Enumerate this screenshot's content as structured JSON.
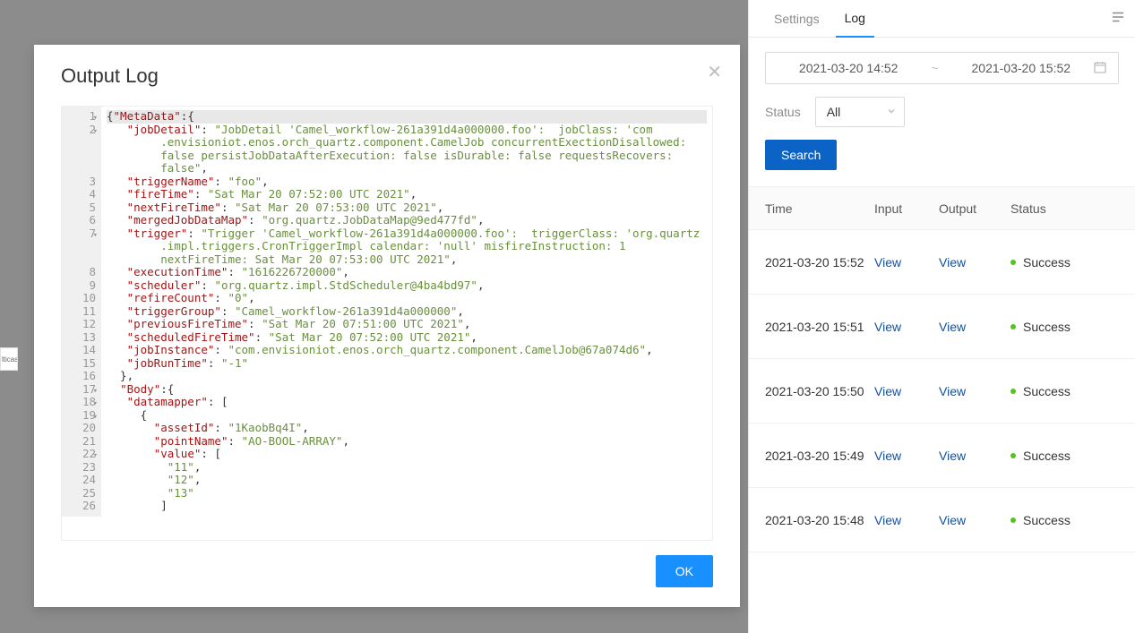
{
  "sidepanel": {
    "tabs": {
      "settings": "Settings",
      "log": "Log"
    },
    "activeTab": "log",
    "dateFrom": "2021-03-20 14:52",
    "dateSep": "~",
    "dateTo": "2021-03-20 15:52",
    "statusLabel": "Status",
    "statusValue": "All",
    "searchLabel": "Search",
    "columns": {
      "time": "Time",
      "input": "Input",
      "output": "Output",
      "status": "Status"
    },
    "viewLabel": "View",
    "rows": [
      {
        "time": "2021-03-20 15:52",
        "status": "Success",
        "statusColor": "green"
      },
      {
        "time": "2021-03-20 15:51",
        "status": "Success",
        "statusColor": "green"
      },
      {
        "time": "2021-03-20 15:50",
        "status": "Success",
        "statusColor": "green"
      },
      {
        "time": "2021-03-20 15:49",
        "status": "Success",
        "statusColor": "green"
      },
      {
        "time": "2021-03-20 15:48",
        "status": "Success",
        "statusColor": "green"
      }
    ]
  },
  "leftFragment": "lticast",
  "modal": {
    "title": "Output Log",
    "okLabel": "OK",
    "code": {
      "lineNumbers": [
        1,
        2,
        3,
        4,
        5,
        6,
        7,
        8,
        9,
        10,
        11,
        12,
        13,
        14,
        15,
        16,
        17,
        18,
        19,
        20,
        21,
        22,
        23,
        24,
        25,
        26
      ],
      "foldLines": [
        1,
        2,
        7,
        17,
        18,
        19,
        22
      ],
      "lines": [
        [
          {
            "t": "{",
            "c": "p"
          },
          {
            "t": "\"MetaData\"",
            "c": "k"
          },
          {
            "t": ":{",
            "c": "p"
          }
        ],
        [
          {
            "t": "   ",
            "c": "p"
          },
          {
            "t": "\"jobDetail\"",
            "c": "k"
          },
          {
            "t": ": ",
            "c": "p"
          },
          {
            "t": "\"JobDetail 'Camel_workflow-261a391d4a000000.foo':  jobClass: 'com",
            "c": "s"
          }
        ],
        [
          {
            "t": "        ",
            "c": "p"
          },
          {
            "t": ".envisioniot.enos.orch_quartz.component.CamelJob concurrentExectionDisallowed: ",
            "c": "s"
          }
        ],
        [
          {
            "t": "        ",
            "c": "p"
          },
          {
            "t": "false persistJobDataAfterExecution: false isDurable: false requestsRecovers: ",
            "c": "s"
          }
        ],
        [
          {
            "t": "        ",
            "c": "p"
          },
          {
            "t": "false\"",
            "c": "s"
          },
          {
            "t": ",",
            "c": "p"
          }
        ],
        [
          {
            "t": "   ",
            "c": "p"
          },
          {
            "t": "\"triggerName\"",
            "c": "k"
          },
          {
            "t": ": ",
            "c": "p"
          },
          {
            "t": "\"foo\"",
            "c": "s"
          },
          {
            "t": ",",
            "c": "p"
          }
        ],
        [
          {
            "t": "   ",
            "c": "p"
          },
          {
            "t": "\"fireTime\"",
            "c": "k"
          },
          {
            "t": ": ",
            "c": "p"
          },
          {
            "t": "\"Sat Mar 20 07:52:00 UTC 2021\"",
            "c": "s"
          },
          {
            "t": ",",
            "c": "p"
          }
        ],
        [
          {
            "t": "   ",
            "c": "p"
          },
          {
            "t": "\"nextFireTime\"",
            "c": "k"
          },
          {
            "t": ": ",
            "c": "p"
          },
          {
            "t": "\"Sat Mar 20 07:53:00 UTC 2021\"",
            "c": "s"
          },
          {
            "t": ",",
            "c": "p"
          }
        ],
        [
          {
            "t": "   ",
            "c": "p"
          },
          {
            "t": "\"mergedJobDataMap\"",
            "c": "k"
          },
          {
            "t": ": ",
            "c": "p"
          },
          {
            "t": "\"org.quartz.JobDataMap@9ed477fd\"",
            "c": "s"
          },
          {
            "t": ",",
            "c": "p"
          }
        ],
        [
          {
            "t": "   ",
            "c": "p"
          },
          {
            "t": "\"trigger\"",
            "c": "k"
          },
          {
            "t": ": ",
            "c": "p"
          },
          {
            "t": "\"Trigger 'Camel_workflow-261a391d4a000000.foo':  triggerClass: 'org.quartz",
            "c": "s"
          }
        ],
        [
          {
            "t": "        ",
            "c": "p"
          },
          {
            "t": ".impl.triggers.CronTriggerImpl calendar: 'null' misfireInstruction: 1 ",
            "c": "s"
          }
        ],
        [
          {
            "t": "        ",
            "c": "p"
          },
          {
            "t": "nextFireTime: Sat Mar 20 07:53:00 UTC 2021\"",
            "c": "s"
          },
          {
            "t": ",",
            "c": "p"
          }
        ],
        [
          {
            "t": "   ",
            "c": "p"
          },
          {
            "t": "\"executionTime\"",
            "c": "k"
          },
          {
            "t": ": ",
            "c": "p"
          },
          {
            "t": "\"1616226720000\"",
            "c": "s"
          },
          {
            "t": ",",
            "c": "p"
          }
        ],
        [
          {
            "t": "   ",
            "c": "p"
          },
          {
            "t": "\"scheduler\"",
            "c": "k"
          },
          {
            "t": ": ",
            "c": "p"
          },
          {
            "t": "\"org.quartz.impl.StdScheduler@4ba4bd97\"",
            "c": "s"
          },
          {
            "t": ",",
            "c": "p"
          }
        ],
        [
          {
            "t": "   ",
            "c": "p"
          },
          {
            "t": "\"refireCount\"",
            "c": "k"
          },
          {
            "t": ": ",
            "c": "p"
          },
          {
            "t": "\"0\"",
            "c": "s"
          },
          {
            "t": ",",
            "c": "p"
          }
        ],
        [
          {
            "t": "   ",
            "c": "p"
          },
          {
            "t": "\"triggerGroup\"",
            "c": "k"
          },
          {
            "t": ": ",
            "c": "p"
          },
          {
            "t": "\"Camel_workflow-261a391d4a000000\"",
            "c": "s"
          },
          {
            "t": ",",
            "c": "p"
          }
        ],
        [
          {
            "t": "   ",
            "c": "p"
          },
          {
            "t": "\"previousFireTime\"",
            "c": "k"
          },
          {
            "t": ": ",
            "c": "p"
          },
          {
            "t": "\"Sat Mar 20 07:51:00 UTC 2021\"",
            "c": "s"
          },
          {
            "t": ",",
            "c": "p"
          }
        ],
        [
          {
            "t": "   ",
            "c": "p"
          },
          {
            "t": "\"scheduledFireTime\"",
            "c": "k"
          },
          {
            "t": ": ",
            "c": "p"
          },
          {
            "t": "\"Sat Mar 20 07:52:00 UTC 2021\"",
            "c": "s"
          },
          {
            "t": ",",
            "c": "p"
          }
        ],
        [
          {
            "t": "   ",
            "c": "p"
          },
          {
            "t": "\"jobInstance\"",
            "c": "k"
          },
          {
            "t": ": ",
            "c": "p"
          },
          {
            "t": "\"com.envisioniot.enos.orch_quartz.component.CamelJob@67a074d6\"",
            "c": "s"
          },
          {
            "t": ",",
            "c": "p"
          }
        ],
        [
          {
            "t": "   ",
            "c": "p"
          },
          {
            "t": "\"jobRunTime\"",
            "c": "k"
          },
          {
            "t": ": ",
            "c": "p"
          },
          {
            "t": "\"-1\"",
            "c": "s"
          }
        ],
        [
          {
            "t": "  },",
            "c": "p"
          }
        ],
        [
          {
            "t": "  ",
            "c": "p"
          },
          {
            "t": "\"Body\"",
            "c": "k"
          },
          {
            "t": ":{",
            "c": "p"
          }
        ],
        [
          {
            "t": "   ",
            "c": "p"
          },
          {
            "t": "\"datamapper\"",
            "c": "k"
          },
          {
            "t": ": [",
            "c": "p"
          }
        ],
        [
          {
            "t": "     {",
            "c": "p"
          }
        ],
        [
          {
            "t": "       ",
            "c": "p"
          },
          {
            "t": "\"assetId\"",
            "c": "k"
          },
          {
            "t": ": ",
            "c": "p"
          },
          {
            "t": "\"1KaobBq4I\"",
            "c": "s"
          },
          {
            "t": ",",
            "c": "p"
          }
        ],
        [
          {
            "t": "       ",
            "c": "p"
          },
          {
            "t": "\"pointName\"",
            "c": "k"
          },
          {
            "t": ": ",
            "c": "p"
          },
          {
            "t": "\"AO-BOOL-ARRAY\"",
            "c": "s"
          },
          {
            "t": ",",
            "c": "p"
          }
        ],
        [
          {
            "t": "       ",
            "c": "p"
          },
          {
            "t": "\"value\"",
            "c": "k"
          },
          {
            "t": ": [",
            "c": "p"
          }
        ],
        [
          {
            "t": "         ",
            "c": "p"
          },
          {
            "t": "\"11\"",
            "c": "s"
          },
          {
            "t": ",",
            "c": "p"
          }
        ],
        [
          {
            "t": "         ",
            "c": "p"
          },
          {
            "t": "\"12\"",
            "c": "s"
          },
          {
            "t": ",",
            "c": "p"
          }
        ],
        [
          {
            "t": "         ",
            "c": "p"
          },
          {
            "t": "\"13\"",
            "c": "s"
          }
        ],
        [
          {
            "t": "        ]",
            "c": "p"
          }
        ]
      ],
      "displayLineMap": [
        0,
        1,
        5,
        6,
        7,
        8,
        9,
        12,
        13,
        14,
        15,
        16,
        17,
        18,
        19,
        20,
        21,
        22,
        23,
        24,
        25,
        26,
        27,
        28,
        29,
        30
      ]
    }
  }
}
